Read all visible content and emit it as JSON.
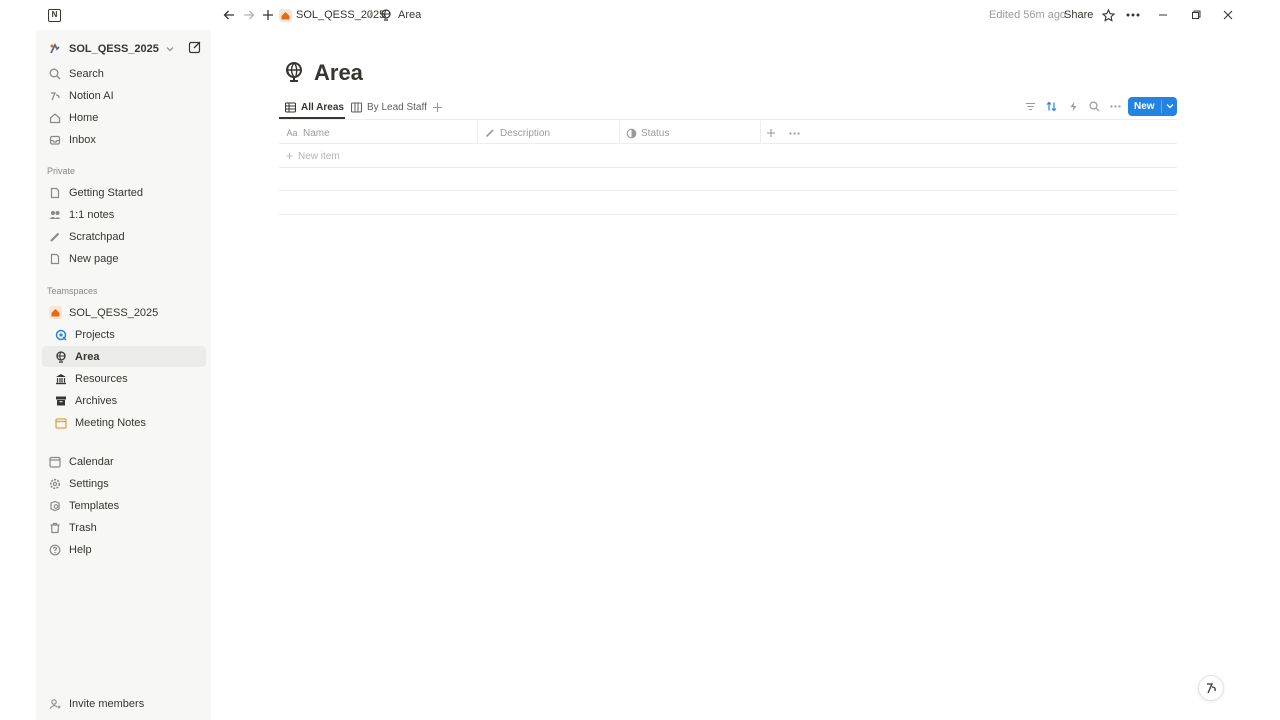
{
  "window": {
    "app_logo_icon": "notion-logo-icon",
    "edited_text": "Edited 56m ago",
    "share_label": "Share"
  },
  "breadcrumb": {
    "workspace": "SOL_QESS_2025",
    "separator": "/",
    "page": "Area"
  },
  "sidebar": {
    "workspace_name": "SOL_QESS_2025",
    "top_items": [
      {
        "label": "Search",
        "icon": "search-icon"
      },
      {
        "label": "Notion AI",
        "icon": "notion-ai-icon"
      },
      {
        "label": "Home",
        "icon": "home-icon"
      },
      {
        "label": "Inbox",
        "icon": "inbox-icon"
      }
    ],
    "private_heading": "Private",
    "private_items": [
      {
        "label": "Getting Started",
        "icon": "page-icon"
      },
      {
        "label": "1:1 notes",
        "icon": "people-icon"
      },
      {
        "label": "Scratchpad",
        "icon": "pencil-icon"
      },
      {
        "label": "New page",
        "icon": "page-icon"
      }
    ],
    "teamspaces_heading": "Teamspaces",
    "teamspace_name": "SOL_QESS_2025",
    "teamspace_items": [
      {
        "label": "Projects",
        "icon": "target-icon"
      },
      {
        "label": "Area",
        "icon": "globe-icon"
      },
      {
        "label": "Resources",
        "icon": "bank-icon"
      },
      {
        "label": "Archives",
        "icon": "archive-icon"
      },
      {
        "label": "Meeting Notes",
        "icon": "calendar-icon"
      }
    ],
    "bottom_items": [
      {
        "label": "Calendar",
        "icon": "calendar-icon"
      },
      {
        "label": "Settings",
        "icon": "gear-icon"
      },
      {
        "label": "Templates",
        "icon": "templates-icon"
      },
      {
        "label": "Trash",
        "icon": "trash-icon"
      },
      {
        "label": "Help",
        "icon": "help-icon"
      }
    ],
    "invite_label": "Invite members"
  },
  "page": {
    "title": "Area",
    "icon": "globe-icon"
  },
  "views": {
    "tabs": [
      {
        "label": "All Areas",
        "icon": "table-icon",
        "active": true
      },
      {
        "label": "By Lead Staff",
        "icon": "board-icon",
        "active": false
      }
    ],
    "new_button_label": "New"
  },
  "table": {
    "columns": [
      {
        "label": "Name",
        "icon": "text-icon",
        "icon_text": "Aa"
      },
      {
        "label": "Description",
        "icon": "pencil-icon"
      },
      {
        "label": "Status",
        "icon": "status-icon"
      }
    ],
    "new_item_label": "New item"
  },
  "colors": {
    "accent": "#2383e2",
    "sidebar_bg": "#f7f7f5",
    "text": "#37352f",
    "muted": "#9b9a97",
    "teamspace_orange": "#e16b16"
  }
}
